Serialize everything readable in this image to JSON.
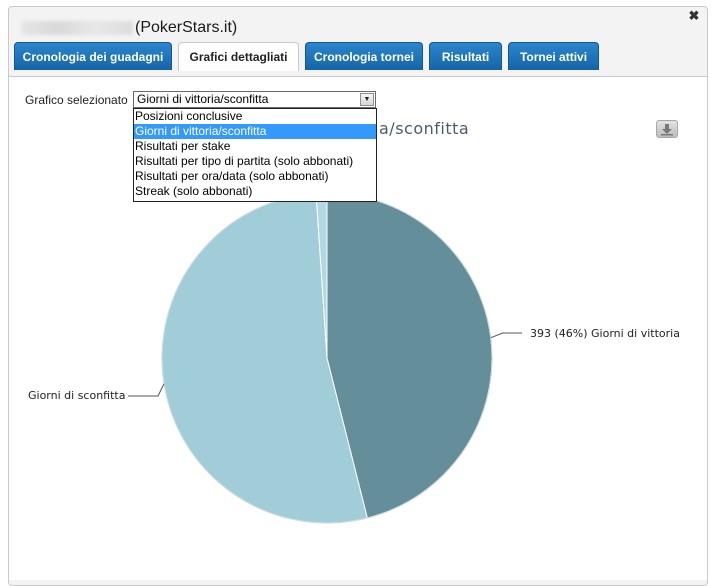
{
  "window": {
    "title": "(PokerStars.it)",
    "close_symbol": "✖"
  },
  "tabs": [
    {
      "label": "Cronologia dei guadagni",
      "active": false
    },
    {
      "label": "Grafici dettagliati",
      "active": true
    },
    {
      "label": "Cronologia tornei",
      "active": false
    },
    {
      "label": "Risultati",
      "active": false
    },
    {
      "label": "Tornei attivi",
      "active": false
    }
  ],
  "chart_selector": {
    "label": "Grafico selezionato",
    "value": "Giorni di vittoria/sconfitta",
    "options": [
      "Posizioni conclusive",
      "Giorni di vittoria/sconfitta",
      "Risultati per stake",
      "Risultati per tipo di partita (solo abbonati)",
      "Risultati per ora/data (solo abbonati)",
      "Streak (solo abbonati)"
    ],
    "selected_index": 1
  },
  "chart_title_visible": "a/sconfitta",
  "export_icon": "download-icon",
  "chart_data": {
    "type": "pie",
    "title": "Giorni di vittoria/sconfitta",
    "slices": [
      {
        "label": "393 (46%) Giorni di vittoria",
        "value": 393,
        "percent": 46,
        "color": "#648e99"
      },
      {
        "label": "Giorni di sconfitta",
        "value": 451,
        "percent": 53,
        "color": "#a1cdd8"
      },
      {
        "label": "",
        "value": 9,
        "percent": 1,
        "color": "#b4d8e1"
      }
    ]
  },
  "colors": {
    "tab_blue": "#1f77c0",
    "win": "#648e99",
    "loss": "#a1cdd8"
  }
}
